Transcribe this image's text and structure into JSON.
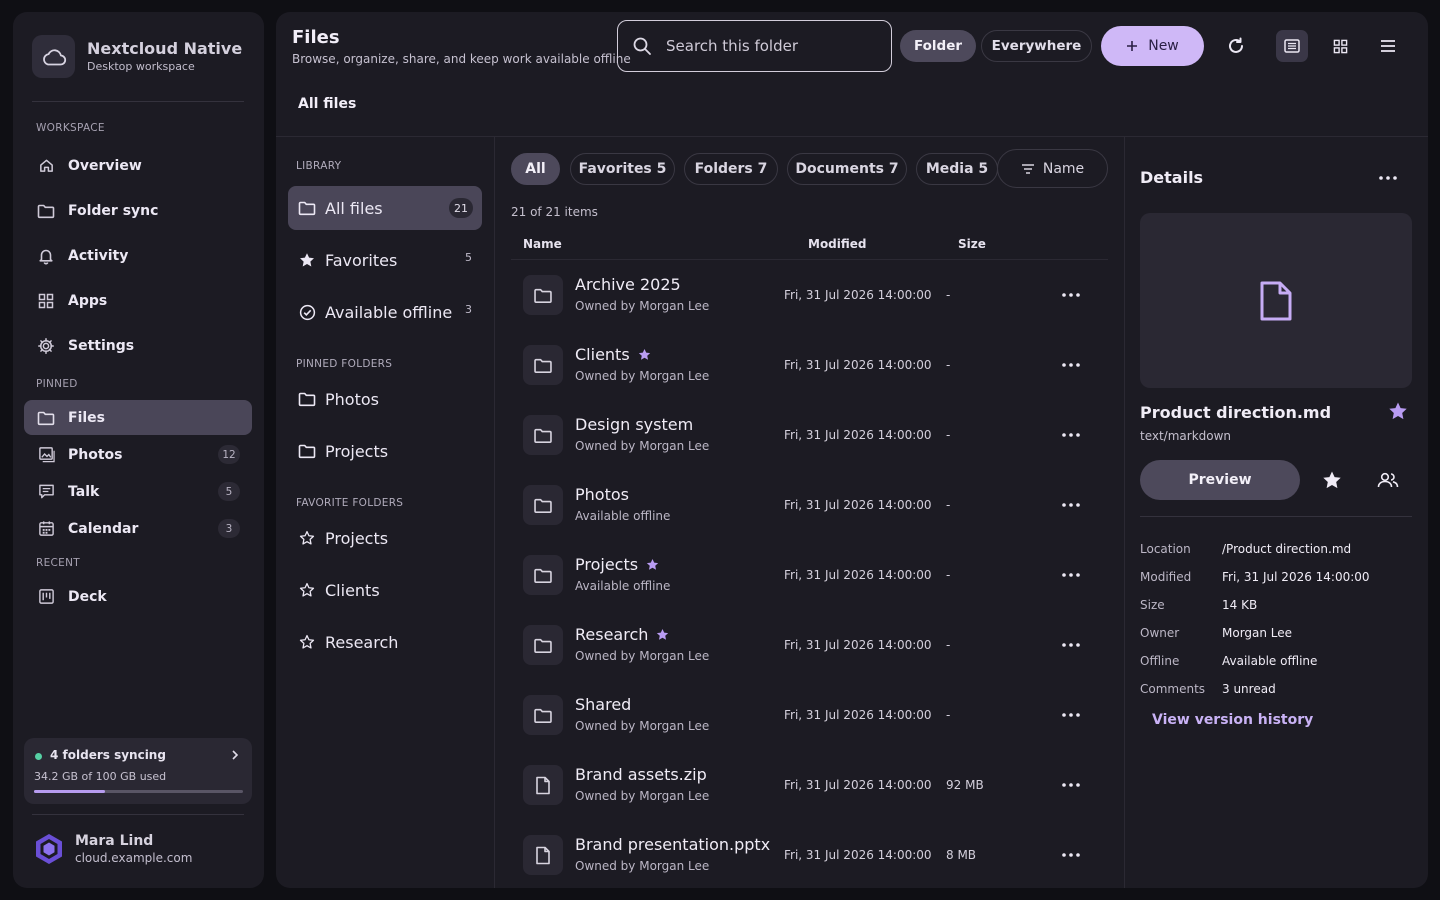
{
  "app": {
    "name": "Nextcloud Native",
    "subtitle": "Desktop workspace"
  },
  "sidebar": {
    "workspace_label": "WORKSPACE",
    "workspace": [
      {
        "label": "Overview",
        "icon": "home-icon"
      },
      {
        "label": "Folder sync",
        "icon": "folder-icon"
      },
      {
        "label": "Activity",
        "icon": "bell-icon"
      },
      {
        "label": "Apps",
        "icon": "grid-icon"
      },
      {
        "label": "Settings",
        "icon": "gear-icon"
      }
    ],
    "pinned_label": "PINNED",
    "pinned": [
      {
        "label": "Files",
        "badge": "",
        "active": true,
        "icon": "folder-icon"
      },
      {
        "label": "Photos",
        "badge": "12",
        "icon": "image-icon"
      },
      {
        "label": "Talk",
        "badge": "5",
        "icon": "chat-icon"
      },
      {
        "label": "Calendar",
        "badge": "3",
        "icon": "calendar-icon"
      }
    ],
    "recent_label": "RECENT",
    "recent": [
      {
        "label": "Deck",
        "icon": "deck-icon"
      }
    ],
    "sync": {
      "title": "4 folders syncing",
      "usage": "34.2 GB of 100 GB used",
      "used_fraction": 0.342
    },
    "user": {
      "name": "Mara Lind",
      "host": "cloud.example.com"
    }
  },
  "header": {
    "title": "Files",
    "subtitle": "Browse, organize, share, and keep work available offline",
    "search_placeholder": "Search this folder",
    "scope_folder": "Folder",
    "scope_everywhere": "Everywhere",
    "new_label": "New"
  },
  "breadcrumb": "All files",
  "library": {
    "label": "LIBRARY",
    "items": [
      {
        "label": "All files",
        "count": "21",
        "icon": "folder-icon",
        "active": true
      },
      {
        "label": "Favorites",
        "count": "5",
        "icon": "star-icon"
      },
      {
        "label": "Available offline",
        "count": "3",
        "icon": "check-circle-icon"
      }
    ],
    "pinned_label": "PINNED FOLDERS",
    "pinned": [
      "Photos",
      "Projects"
    ],
    "favorite_label": "FAVORITE FOLDERS",
    "favorites": [
      "Projects",
      "Clients",
      "Research"
    ]
  },
  "filters": [
    "All",
    "Favorites 5",
    "Folders 7",
    "Documents 7",
    "Media 5"
  ],
  "sort_label": "Name",
  "item_count": "21 of 21 items",
  "columns": {
    "name": "Name",
    "modified": "Modified",
    "size": "Size"
  },
  "files": [
    {
      "name": "Archive 2025",
      "sub": "Owned by Morgan Lee",
      "modified": "Fri, 31 Jul 2026 14:00:00",
      "size": "-",
      "type": "folder",
      "fav": false
    },
    {
      "name": "Clients",
      "sub": "Owned by Morgan Lee",
      "modified": "Fri, 31 Jul 2026 14:00:00",
      "size": "-",
      "type": "folder",
      "fav": true
    },
    {
      "name": "Design system",
      "sub": "Owned by Morgan Lee",
      "modified": "Fri, 31 Jul 2026 14:00:00",
      "size": "-",
      "type": "folder",
      "fav": false
    },
    {
      "name": "Photos",
      "sub": "Available offline",
      "modified": "Fri, 31 Jul 2026 14:00:00",
      "size": "-",
      "type": "folder",
      "fav": false
    },
    {
      "name": "Projects",
      "sub": "Available offline",
      "modified": "Fri, 31 Jul 2026 14:00:00",
      "size": "-",
      "type": "folder",
      "fav": true
    },
    {
      "name": "Research",
      "sub": "Owned by Morgan Lee",
      "modified": "Fri, 31 Jul 2026 14:00:00",
      "size": "-",
      "type": "folder",
      "fav": true
    },
    {
      "name": "Shared",
      "sub": "Owned by Morgan Lee",
      "modified": "Fri, 31 Jul 2026 14:00:00",
      "size": "-",
      "type": "folder",
      "fav": false
    },
    {
      "name": "Brand assets.zip",
      "sub": "Owned by Morgan Lee",
      "modified": "Fri, 31 Jul 2026 14:00:00",
      "size": "92 MB",
      "type": "file",
      "fav": false
    },
    {
      "name": "Brand presentation.pptx",
      "sub": "Owned by Morgan Lee",
      "modified": "Fri, 31 Jul 2026 14:00:00",
      "size": "8 MB",
      "type": "file",
      "fav": false
    }
  ],
  "details": {
    "title": "Details",
    "name": "Product direction.md",
    "mime": "text/markdown",
    "preview_label": "Preview",
    "fields": [
      {
        "k": "Location",
        "v": "/Product direction.md"
      },
      {
        "k": "Modified",
        "v": "Fri, 31 Jul 2026 14:00:00"
      },
      {
        "k": "Size",
        "v": "14 KB"
      },
      {
        "k": "Owner",
        "v": "Morgan Lee"
      },
      {
        "k": "Offline",
        "v": "Available offline"
      },
      {
        "k": "Comments",
        "v": "3 unread"
      }
    ],
    "version_history": "View version history"
  },
  "colors": {
    "accent": "#cfb8f7",
    "accent_text": "#c9b2f5",
    "sync_ok": "#56d0a4"
  }
}
